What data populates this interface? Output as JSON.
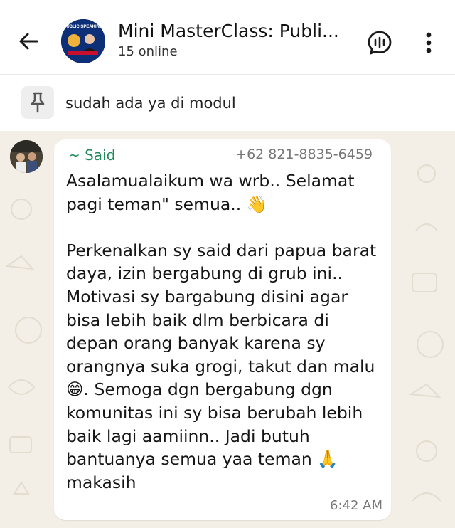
{
  "header": {
    "title": "Mini MasterClass: Publi...",
    "subtitle": "15 online",
    "avatar_caption": "PUBLIC SPEAKING",
    "icons": {
      "back": "arrow-left-icon",
      "voice_chat": "voice-chat-icon",
      "menu": "more-vertical-icon"
    }
  },
  "pinned": {
    "icon": "pin-icon",
    "text": "sudah ada ya di modul"
  },
  "message": {
    "sender_name": "~ Said",
    "sender_phone": "+62 821-8835-6459",
    "text": "Asalamualaikum wa wrb.. Selamat pagi teman\" semua.. 👋\n\nPerkenalkan sy said dari papua barat daya, izin bergabung di grub ini.. Motivasi sy bargabung disini agar bisa lebih baik dlm berbicara di depan orang banyak karena sy orangnya suka grogi, takut dan malu 😁. Semoga dgn bergabung dgn komunitas ini sy bisa berubah lebih baik lagi aamiinn.. Jadi butuh bantuanya semua yaa teman 🙏 makasih",
    "time": "6:42 AM"
  },
  "colors": {
    "header_bg": "#ffffff",
    "chat_bg": "#f3eee6",
    "bubble_bg": "#ffffff",
    "sender_name": "#1f8a5a",
    "secondary_text": "#777777"
  }
}
